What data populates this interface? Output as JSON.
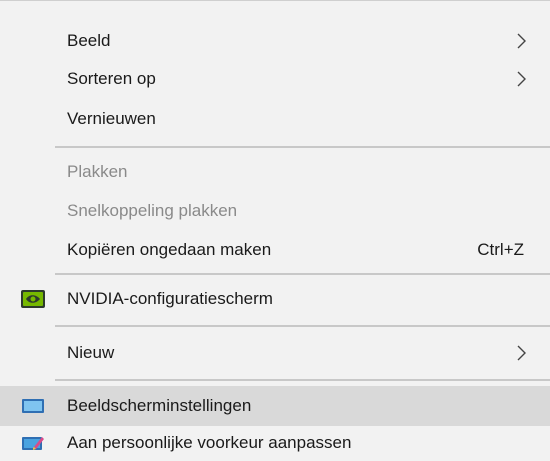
{
  "menu": {
    "items": [
      {
        "label": "Beeld",
        "submenu": true
      },
      {
        "label": "Sorteren op",
        "submenu": true
      },
      {
        "label": "Vernieuwen"
      },
      {
        "label": "Plakken",
        "disabled": true
      },
      {
        "label": "Snelkoppeling plakken",
        "disabled": true
      },
      {
        "label": "Kopiëren ongedaan maken",
        "shortcut": "Ctrl+Z"
      },
      {
        "label": "NVIDIA-configuratiescherm",
        "icon": "nvidia-icon"
      },
      {
        "label": "Nieuw",
        "submenu": true
      },
      {
        "label": "Beeldscherminstellingen",
        "icon": "display-settings-icon",
        "highlighted": true
      },
      {
        "label": "Aan persoonlijke voorkeur aanpassen",
        "icon": "personalize-icon"
      }
    ]
  },
  "colors": {
    "menu_background": "#f2f2f2",
    "highlight_background": "#d9d9d9",
    "disabled_text": "#8a8a8a",
    "separator": "#c8c8c8",
    "nvidia_green": "#76b900"
  }
}
